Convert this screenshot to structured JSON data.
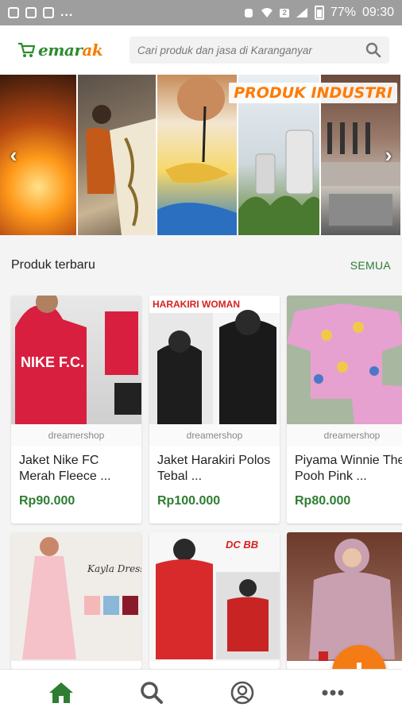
{
  "status_bar": {
    "battery": "77%",
    "time": "09:30",
    "sim": "2",
    "more_dots": "..."
  },
  "header": {
    "logo_text_1": "emar",
    "logo_text_2": "ak",
    "search_placeholder": "Cari produk dan jasa di Karanganyar",
    "icon": "search-icon"
  },
  "banner": {
    "title": "PRODUK INDUSTRI",
    "prev_icon": "chevron-left-icon",
    "next_icon": "chevron-right-icon"
  },
  "section": {
    "title": "Produk terbaru",
    "link": "SEMUA"
  },
  "products": [
    {
      "shop": "dreamershop",
      "name": "Jaket Nike FC Merah Fleece ...",
      "price": "Rp90.000",
      "image_text": "NIKE F.C."
    },
    {
      "shop": "dreamershop",
      "name": "Jaket Harakiri Polos Tebal ...",
      "price": "Rp100.000",
      "image_text": "HARAKIRI WOMAN"
    },
    {
      "shop": "dreamershop",
      "name": "Piyama Winnie The Pooh Pink ...",
      "price": "Rp80.000",
      "image_text": ""
    },
    {
      "shop": "",
      "name": "",
      "price": "",
      "image_text": "Kayla Dress"
    },
    {
      "shop": "",
      "name": "",
      "price": "",
      "image_text": "DC BB"
    },
    {
      "shop": "",
      "name": "",
      "price": "",
      "image_text": ""
    }
  ],
  "bottom_nav": [
    {
      "icon": "home-icon",
      "active": true
    },
    {
      "icon": "search-icon",
      "active": false
    },
    {
      "icon": "user-circle-icon",
      "active": false
    },
    {
      "icon": "more-icon",
      "active": false
    }
  ],
  "fab": {
    "icon": "plus-icon"
  },
  "colors": {
    "brand_green": "#2e7d32",
    "brand_orange": "#f57c14",
    "status_bar": "#9e9e9e"
  }
}
